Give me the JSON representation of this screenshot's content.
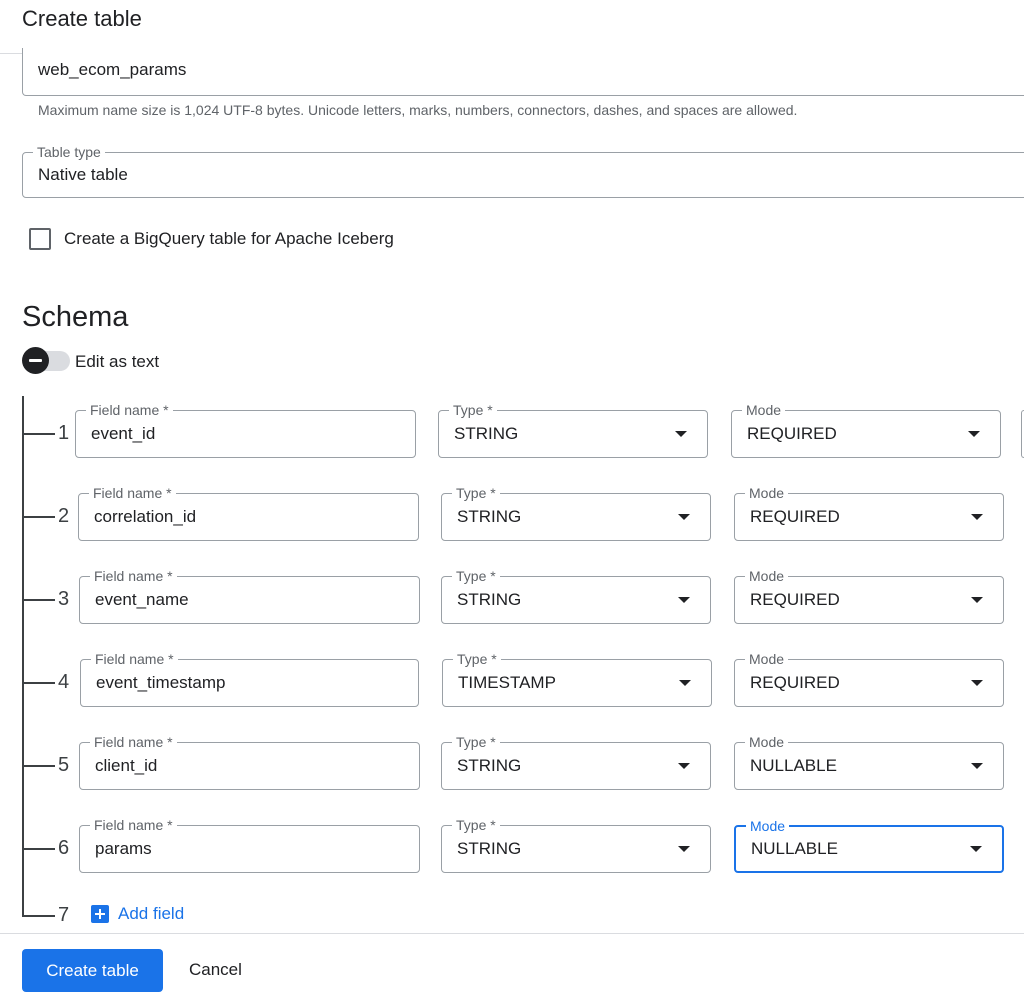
{
  "header": {
    "title": "Create table"
  },
  "table_name": {
    "value": "web_ecom_params",
    "hint": "Maximum name size is 1,024 UTF-8 bytes. Unicode letters, marks, numbers, connectors, dashes, and spaces are allowed."
  },
  "table_type": {
    "label": "Table type",
    "value": "Native table"
  },
  "iceberg": {
    "label": "Create a BigQuery table for Apache Iceberg",
    "checked": false
  },
  "schema": {
    "title": "Schema",
    "edit_as_text_label": "Edit as text",
    "field_name_label": "Field name *",
    "type_label": "Type *",
    "mode_label": "Mode",
    "rows": [
      {
        "num": "1",
        "name": "event_id",
        "type": "STRING",
        "mode": "REQUIRED"
      },
      {
        "num": "2",
        "name": "correlation_id",
        "type": "STRING",
        "mode": "REQUIRED"
      },
      {
        "num": "3",
        "name": "event_name",
        "type": "STRING",
        "mode": "REQUIRED"
      },
      {
        "num": "4",
        "name": "event_timestamp",
        "type": "TIMESTAMP",
        "mode": "REQUIRED"
      },
      {
        "num": "5",
        "name": "client_id",
        "type": "STRING",
        "mode": "NULLABLE"
      },
      {
        "num": "6",
        "name": "params",
        "type": "STRING",
        "mode": "NULLABLE"
      }
    ],
    "add_field": {
      "num": "7",
      "label": "Add field"
    }
  },
  "footer": {
    "create_label": "Create table",
    "cancel_label": "Cancel"
  },
  "colors": {
    "accent": "#1a73e8"
  }
}
